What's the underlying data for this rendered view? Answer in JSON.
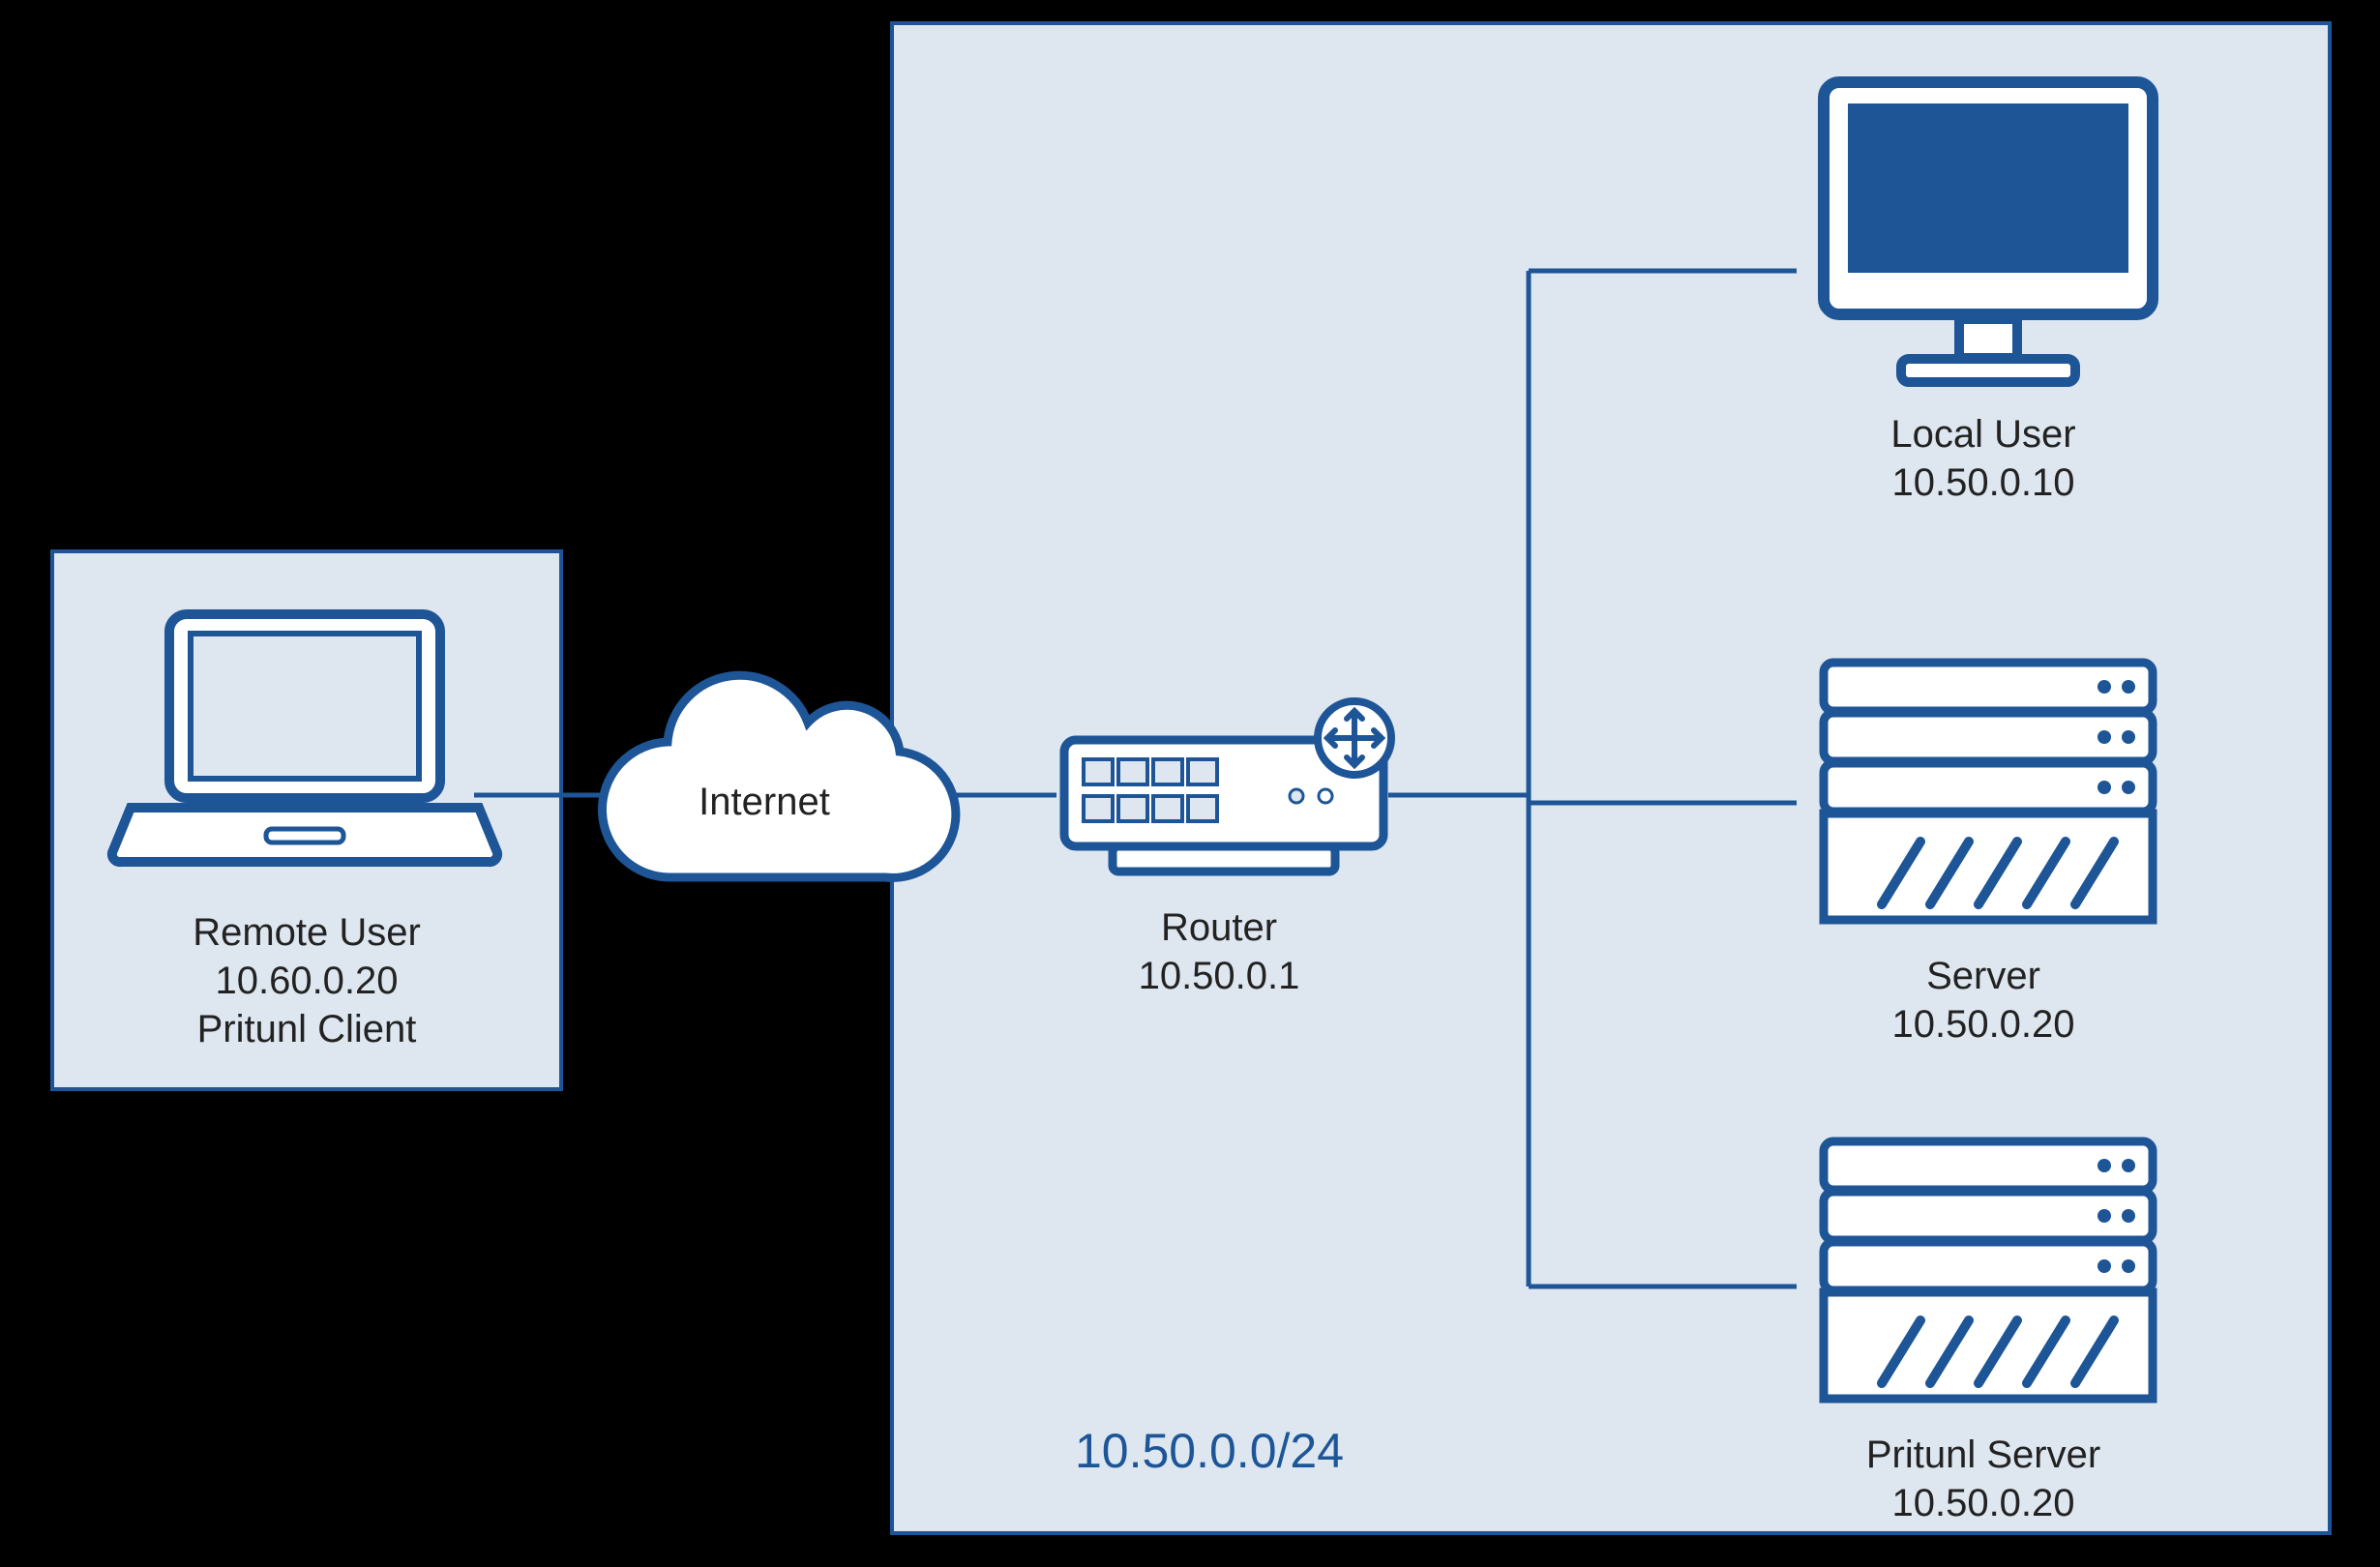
{
  "remote": {
    "title": "Remote User",
    "ip": "10.60.0.20",
    "sub": "Pritunl Client"
  },
  "internet": {
    "label": "Internet"
  },
  "router": {
    "title": "Router",
    "ip": "10.50.0.1"
  },
  "subnet": {
    "cidr": "10.50.0.0/24"
  },
  "localuser": {
    "title": "Local User",
    "ip": "10.50.0.10"
  },
  "server": {
    "title": "Server",
    "ip": "10.50.0.20"
  },
  "pritunl": {
    "title": "Pritunl Server",
    "ip": "10.50.0.20"
  },
  "colors": {
    "stroke": "#1d5597",
    "fill": "#dee7f0"
  }
}
